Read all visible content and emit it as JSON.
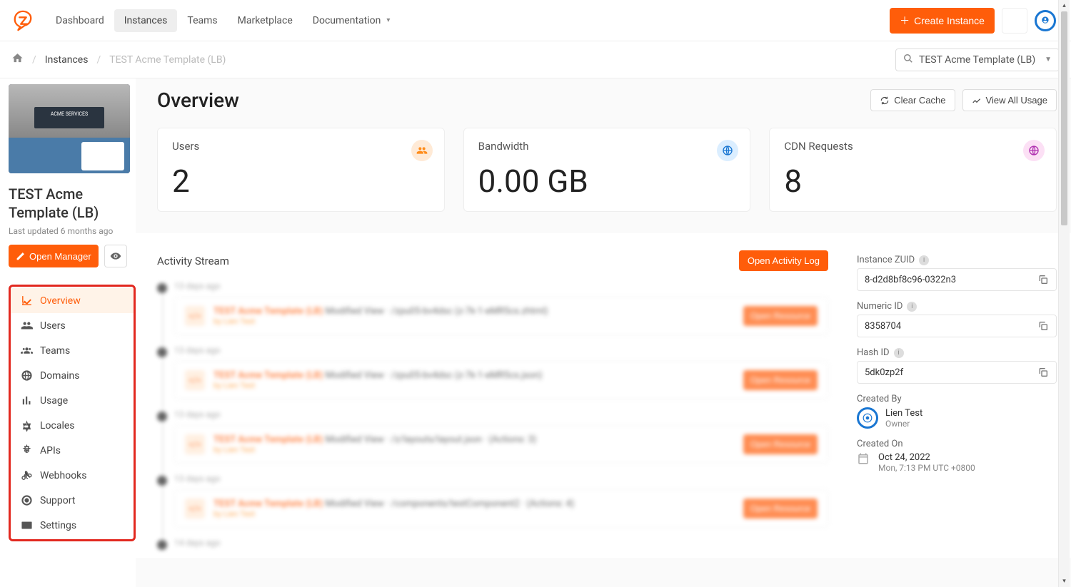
{
  "topnav": {
    "items": [
      "Dashboard",
      "Instances",
      "Teams",
      "Marketplace",
      "Documentation"
    ],
    "active": 1,
    "create_btn": "Create Instance"
  },
  "breadcrumb": {
    "home": "⌂",
    "level1": "Instances",
    "level2": "TEST Acme Template (LB)",
    "search_value": "TEST Acme Template (LB)"
  },
  "sidebar": {
    "title": "TEST Acme Template (LB)",
    "subtitle": "Last updated 6 months ago",
    "open_btn": "Open Manager",
    "preview_banner": "ACME SERVICES",
    "menu": [
      {
        "icon": "chart",
        "label": "Overview"
      },
      {
        "icon": "users",
        "label": "Users"
      },
      {
        "icon": "teams",
        "label": "Teams"
      },
      {
        "icon": "globe",
        "label": "Domains"
      },
      {
        "icon": "bars",
        "label": "Usage"
      },
      {
        "icon": "lang",
        "label": "Locales"
      },
      {
        "icon": "api",
        "label": "APIs"
      },
      {
        "icon": "hook",
        "label": "Webhooks"
      },
      {
        "icon": "support",
        "label": "Support"
      },
      {
        "icon": "settings",
        "label": "Settings"
      }
    ],
    "active_menu": 0
  },
  "overview": {
    "title": "Overview",
    "clear_cache": "Clear Cache",
    "view_usage": "View All Usage",
    "stats": [
      {
        "label": "Users",
        "value": "2",
        "icon": "users",
        "color": "org"
      },
      {
        "label": "Bandwidth",
        "value": "0.00 GB",
        "icon": "globe",
        "color": "blu"
      },
      {
        "label": "CDN Requests",
        "value": "8",
        "icon": "globe",
        "color": "pur"
      }
    ]
  },
  "activity": {
    "title": "Activity Stream",
    "open_log": "Open Activity Log",
    "groups": [
      {
        "time": "13 days ago",
        "items": [
          {
            "title": "TEST Acme Template (LB)",
            "desc": "Modified View · /zpu05-bv4dsc (z-7k-1-eMR5cs.zhtml)",
            "by": "by Lien Test",
            "btn": "Open Resource"
          }
        ]
      },
      {
        "time": "13 days ago",
        "items": [
          {
            "title": "TEST Acme Template (LB)",
            "desc": "Modified View · /zpu05-bv4dsc (z-7k-1-eMR5cs.json)",
            "by": "by Lien Test",
            "btn": "Open Resource"
          }
        ]
      },
      {
        "time": "13 days ago",
        "items": [
          {
            "title": "TEST Acme Template (LB)",
            "desc": "Modified View · /z/layouts/layout.json · (Actions: 3)",
            "by": "by Lien Test",
            "btn": "Open Resource"
          }
        ]
      },
      {
        "time": "13 days ago",
        "items": [
          {
            "title": "TEST Acme Template (LB)",
            "desc": "Modified View · /components/testComponent2 · (Actions: 4)",
            "by": "by Lien Test",
            "btn": "Open Resource"
          }
        ]
      },
      {
        "time": "14 days ago",
        "items": []
      }
    ]
  },
  "meta": {
    "zuid_label": "Instance ZUID",
    "zuid": "8-d2d8bf8c96-0322n3",
    "numeric_label": "Numeric ID",
    "numeric": "8358704",
    "hash_label": "Hash ID",
    "hash": "5dk0zp2f",
    "created_by_label": "Created By",
    "created_by_name": "Lien Test",
    "created_by_role": "Owner",
    "created_on_label": "Created On",
    "created_on_date": "Oct 24, 2022",
    "created_on_time": "Mon, 7:13 PM UTC +0800"
  }
}
